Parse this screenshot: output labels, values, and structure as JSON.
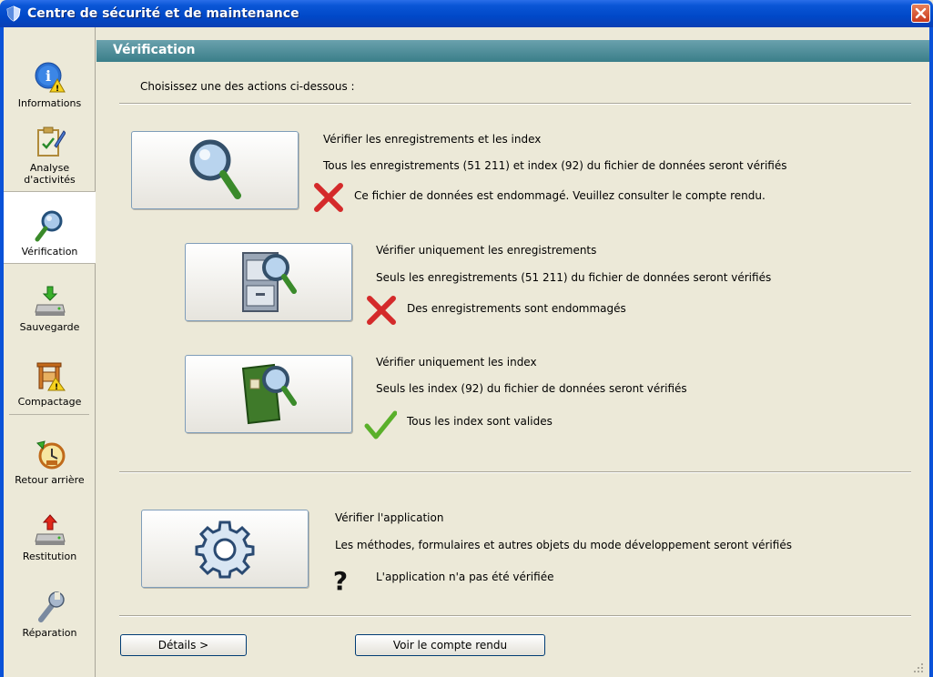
{
  "window": {
    "title": "Centre de sécurité et de maintenance",
    "close_icon": "close-icon"
  },
  "sidebar": {
    "items": [
      {
        "label": "Informations",
        "icon": "info-warning-icon"
      },
      {
        "label": "Analyse\nd'activités",
        "icon": "clipboard-analysis-icon"
      },
      {
        "label": "Vérification",
        "icon": "magnifier-icon",
        "active": true
      },
      {
        "label": "Sauvegarde",
        "icon": "backup-drive-icon"
      },
      {
        "label": "Compactage",
        "icon": "compact-press-icon"
      },
      {
        "label": "Retour arrière",
        "icon": "rollback-clock-icon"
      },
      {
        "label": "Restitution",
        "icon": "restore-drive-icon"
      },
      {
        "label": "Réparation",
        "icon": "wrench-icon"
      }
    ]
  },
  "main": {
    "section_title": "Vérification",
    "intro": "Choisissez une des actions ci-dessous :",
    "actions": [
      {
        "title": "Vérifier les enregistrements et les index",
        "description": "Tous les enregistrements (51 211) et index (92) du fichier de données seront vérifiés",
        "status": "Ce fichier de données est endommagé. Veuillez consulter le compte rendu.",
        "status_type": "error"
      },
      {
        "title": "Vérifier uniquement les enregistrements",
        "description": "Seuls les enregistrements (51 211) du fichier de données seront vérifiés",
        "status": "Des enregistrements sont endommagés",
        "status_type": "error"
      },
      {
        "title": "Vérifier uniquement les index",
        "description": "Seuls les index (92) du fichier de données seront vérifiés",
        "status": "Tous les index sont valides",
        "status_type": "ok"
      },
      {
        "title": "Vérifier l'application",
        "description": "Les méthodes, formulaires et autres objets du mode développement seront vérifiés",
        "status": "L'application n'a pas été vérifiée",
        "status_type": "unknown"
      }
    ],
    "details_button": "Détails >",
    "report_button": "Voir le compte rendu"
  },
  "colors": {
    "titlebar": "#0a56d6",
    "section_band": "#4a8a95",
    "error": "#d42a2a",
    "ok": "#4aa82a"
  }
}
